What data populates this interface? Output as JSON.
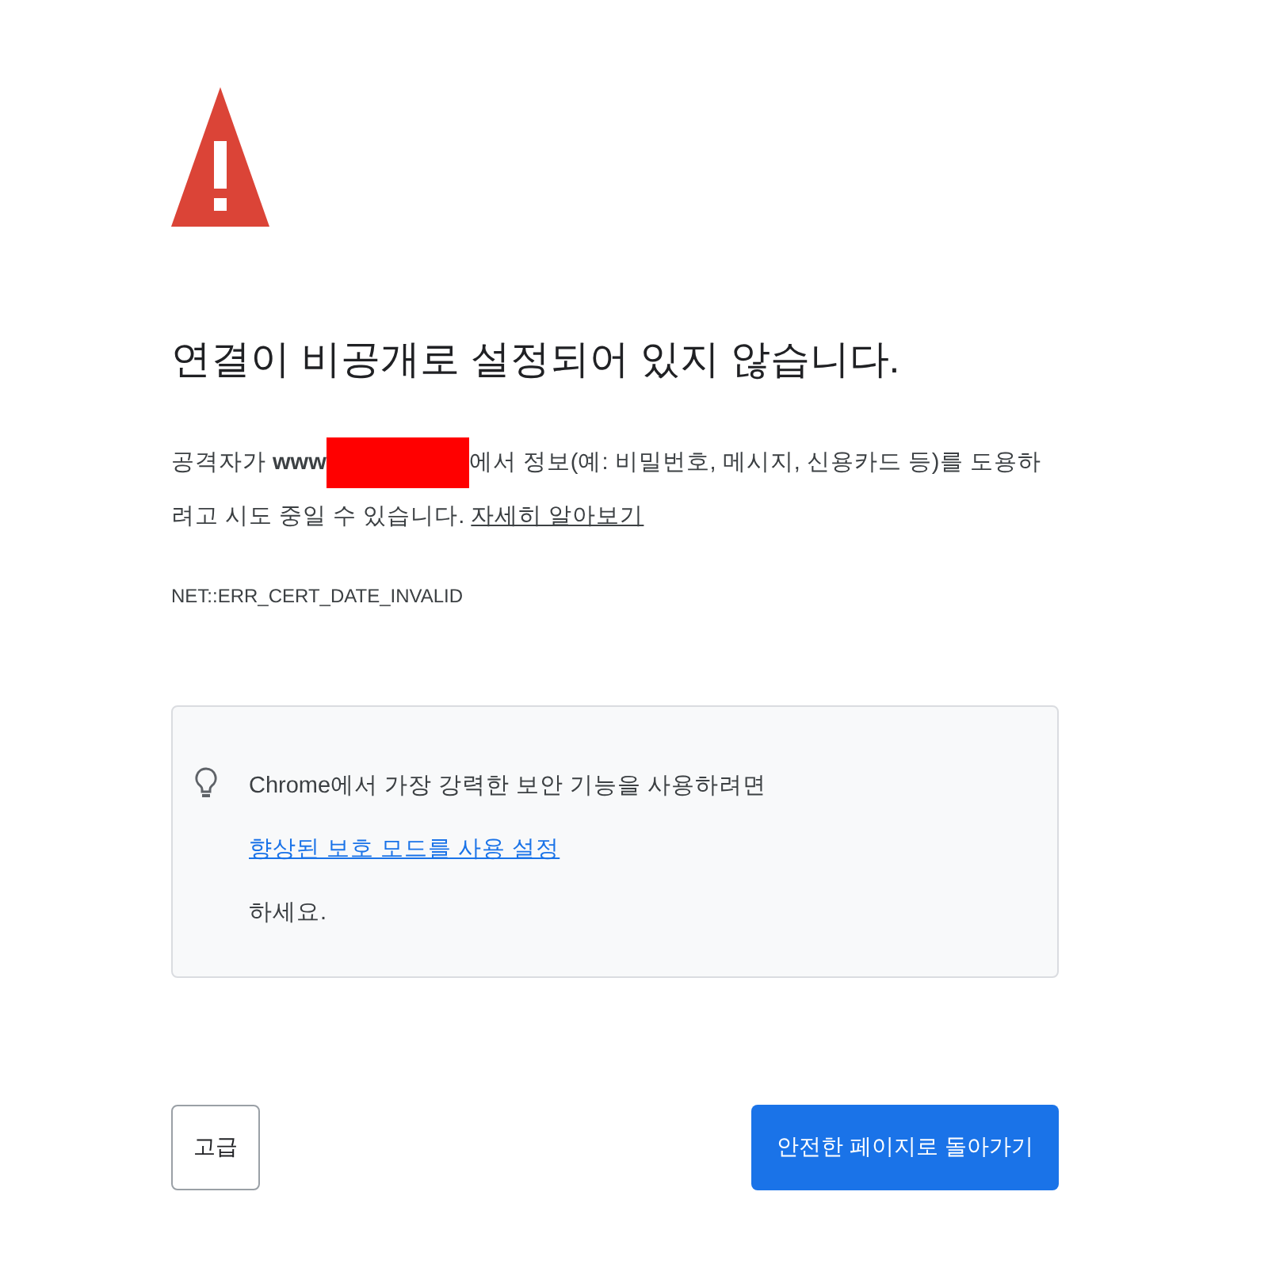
{
  "title": "연결이 비공개로 설정되어 있지 않습니다.",
  "message": {
    "before": "공격자가 **www**",
    "after": "에서 정보(예: 비밀번호, 메시지, 신용카드 등)를 도용하려고 시도 중일 수 있습니다.",
    "link": "자세히 알아보기"
  },
  "error_code": "NET::ERR_CERT_DATE_INVALID",
  "tip": {
    "text": "Chrome에서 가장 강력한 보안 기능을 사용하려면",
    "link": "향상된 보호 모드를 사용 설정",
    "after": "하세요."
  },
  "buttons": [
    {
      "label": "고급",
      "kind": "secondary"
    },
    {
      "label": "안전한 페이지로 돌아가기",
      "kind": "primary"
    }
  ]
}
